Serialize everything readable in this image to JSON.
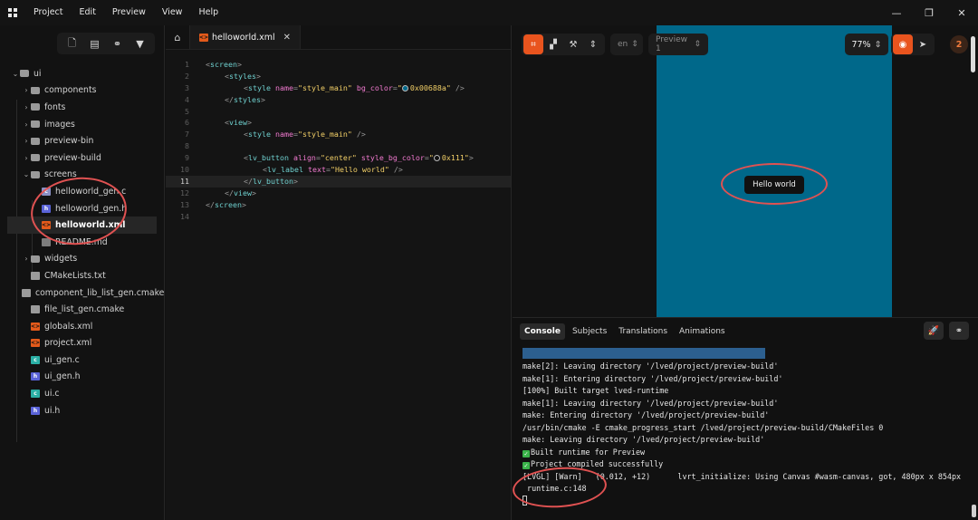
{
  "menu": {
    "items": [
      "Project",
      "Edit",
      "Preview",
      "View",
      "Help"
    ]
  },
  "window_controls": {
    "minimize": "—",
    "maximize": "❐",
    "close": "✕"
  },
  "explorer": {
    "tree": [
      {
        "label": "ui",
        "depth": 0,
        "type": "folder",
        "expanded": true
      },
      {
        "label": "components",
        "depth": 1,
        "type": "folder",
        "expanded": false
      },
      {
        "label": "fonts",
        "depth": 1,
        "type": "folder",
        "expanded": false
      },
      {
        "label": "images",
        "depth": 1,
        "type": "folder",
        "expanded": false
      },
      {
        "label": "preview-bin",
        "depth": 1,
        "type": "folder",
        "expanded": false
      },
      {
        "label": "preview-build",
        "depth": 1,
        "type": "folder",
        "expanded": false
      },
      {
        "label": "screens",
        "depth": 1,
        "type": "folder",
        "expanded": true
      },
      {
        "label": "helloworld_gen.c",
        "depth": 2,
        "type": "gen"
      },
      {
        "label": "helloworld_gen.h",
        "depth": 2,
        "type": "h"
      },
      {
        "label": "helloworld.xml",
        "depth": 2,
        "type": "xml",
        "selected": true
      },
      {
        "label": "README.md",
        "depth": 2,
        "type": "md"
      },
      {
        "label": "widgets",
        "depth": 1,
        "type": "folder",
        "expanded": false
      },
      {
        "label": "CMakeLists.txt",
        "depth": 1,
        "type": "txt"
      },
      {
        "label": "component_lib_list_gen.cmake",
        "depth": 1,
        "type": "txt"
      },
      {
        "label": "file_list_gen.cmake",
        "depth": 1,
        "type": "txt"
      },
      {
        "label": "globals.xml",
        "depth": 1,
        "type": "xml"
      },
      {
        "label": "project.xml",
        "depth": 1,
        "type": "xml"
      },
      {
        "label": "ui_gen.c",
        "depth": 1,
        "type": "c"
      },
      {
        "label": "ui_gen.h",
        "depth": 1,
        "type": "h"
      },
      {
        "label": "ui.c",
        "depth": 1,
        "type": "c"
      },
      {
        "label": "ui.h",
        "depth": 1,
        "type": "h"
      }
    ]
  },
  "editor": {
    "tab_label": "helloworld.xml",
    "active_line": 11,
    "lines": [
      {
        "n": "1",
        "indent": 0,
        "parts": [
          [
            "p",
            "<"
          ],
          [
            "t",
            "screen"
          ],
          [
            "p",
            ">"
          ]
        ]
      },
      {
        "n": "2",
        "indent": 1,
        "parts": [
          [
            "p",
            "<"
          ],
          [
            "t",
            "styles"
          ],
          [
            "p",
            ">"
          ]
        ]
      },
      {
        "n": "3",
        "indent": 2,
        "parts": [
          [
            "p",
            "<"
          ],
          [
            "t",
            "style "
          ],
          [
            "a",
            "name"
          ],
          [
            "p",
            "="
          ],
          [
            "s",
            "\"style_main\""
          ],
          [
            "a",
            " bg_color"
          ],
          [
            "p",
            "="
          ],
          [
            "s",
            "\""
          ],
          [
            "sw",
            "#00688a"
          ],
          [
            "s",
            "0x00688a\""
          ],
          [
            "p",
            " />"
          ]
        ]
      },
      {
        "n": "4",
        "indent": 1,
        "parts": [
          [
            "p",
            "</"
          ],
          [
            "t",
            "styles"
          ],
          [
            "p",
            ">"
          ]
        ]
      },
      {
        "n": "5",
        "indent": 0,
        "parts": []
      },
      {
        "n": "6",
        "indent": 1,
        "parts": [
          [
            "p",
            "<"
          ],
          [
            "t",
            "view"
          ],
          [
            "p",
            ">"
          ]
        ]
      },
      {
        "n": "7",
        "indent": 2,
        "parts": [
          [
            "p",
            "<"
          ],
          [
            "t",
            "style "
          ],
          [
            "a",
            "name"
          ],
          [
            "p",
            "="
          ],
          [
            "s",
            "\"style_main\""
          ],
          [
            "p",
            " />"
          ]
        ]
      },
      {
        "n": "8",
        "indent": 0,
        "parts": []
      },
      {
        "n": "9",
        "indent": 2,
        "parts": [
          [
            "p",
            "<"
          ],
          [
            "t",
            "lv_button "
          ],
          [
            "a",
            "align"
          ],
          [
            "p",
            "="
          ],
          [
            "s",
            "\"center\""
          ],
          [
            "a",
            " style_bg_color"
          ],
          [
            "p",
            "="
          ],
          [
            "s",
            "\""
          ],
          [
            "sw",
            "#111111"
          ],
          [
            "s",
            "0x111\""
          ],
          [
            "p",
            ">"
          ]
        ]
      },
      {
        "n": "10",
        "indent": 3,
        "parts": [
          [
            "p",
            "<"
          ],
          [
            "t",
            "lv_label "
          ],
          [
            "a",
            "text"
          ],
          [
            "p",
            "="
          ],
          [
            "s",
            "\"Hello world\""
          ],
          [
            "p",
            " />"
          ]
        ]
      },
      {
        "n": "11",
        "indent": 2,
        "parts": [
          [
            "p",
            "</"
          ],
          [
            "t",
            "lv_button"
          ],
          [
            "p",
            ">"
          ]
        ]
      },
      {
        "n": "12",
        "indent": 1,
        "parts": [
          [
            "p",
            "</"
          ],
          [
            "t",
            "view"
          ],
          [
            "p",
            ">"
          ]
        ]
      },
      {
        "n": "13",
        "indent": 0,
        "parts": [
          [
            "p",
            "</"
          ],
          [
            "t",
            "screen"
          ],
          [
            "p",
            ">"
          ]
        ]
      },
      {
        "n": "14",
        "indent": 0,
        "parts": []
      }
    ]
  },
  "preview": {
    "locale": "en",
    "preview_select": "Preview 1",
    "zoom": "77%",
    "issues_count": "2",
    "screen_bg": "#00688a",
    "button_label": "Hello world"
  },
  "console": {
    "tabs": [
      "Console",
      "Subjects",
      "Translations",
      "Animations"
    ],
    "active_tab": "Console",
    "progress": 1.0,
    "lines": [
      {
        "text": "make[2]: Leaving directory '/lved/project/preview-build'"
      },
      {
        "text": "make[1]: Entering directory '/lved/project/preview-build'"
      },
      {
        "text": "[100%] Built target lved-runtime"
      },
      {
        "text": "make[1]: Leaving directory '/lved/project/preview-build'"
      },
      {
        "text": "make: Entering directory '/lved/project/preview-build'"
      },
      {
        "text": "/usr/bin/cmake -E cmake_progress_start /lved/project/preview-build/CMakeFiles 0"
      },
      {
        "text": "make: Leaving directory '/lved/project/preview-build'"
      },
      {
        "text": "Built runtime for Preview",
        "ok": true
      },
      {
        "text": "Project compiled successfully",
        "ok": true
      },
      {
        "text": "[LVGL] [Warn]   (0.012, +12)      lvrt_initialize: Using Canvas #wasm-canvas, got, 480px x 854px"
      },
      {
        "text": " runtime.c:148"
      }
    ]
  },
  "colors": {
    "accent": "#e9541e",
    "annotation": "#e05252"
  }
}
